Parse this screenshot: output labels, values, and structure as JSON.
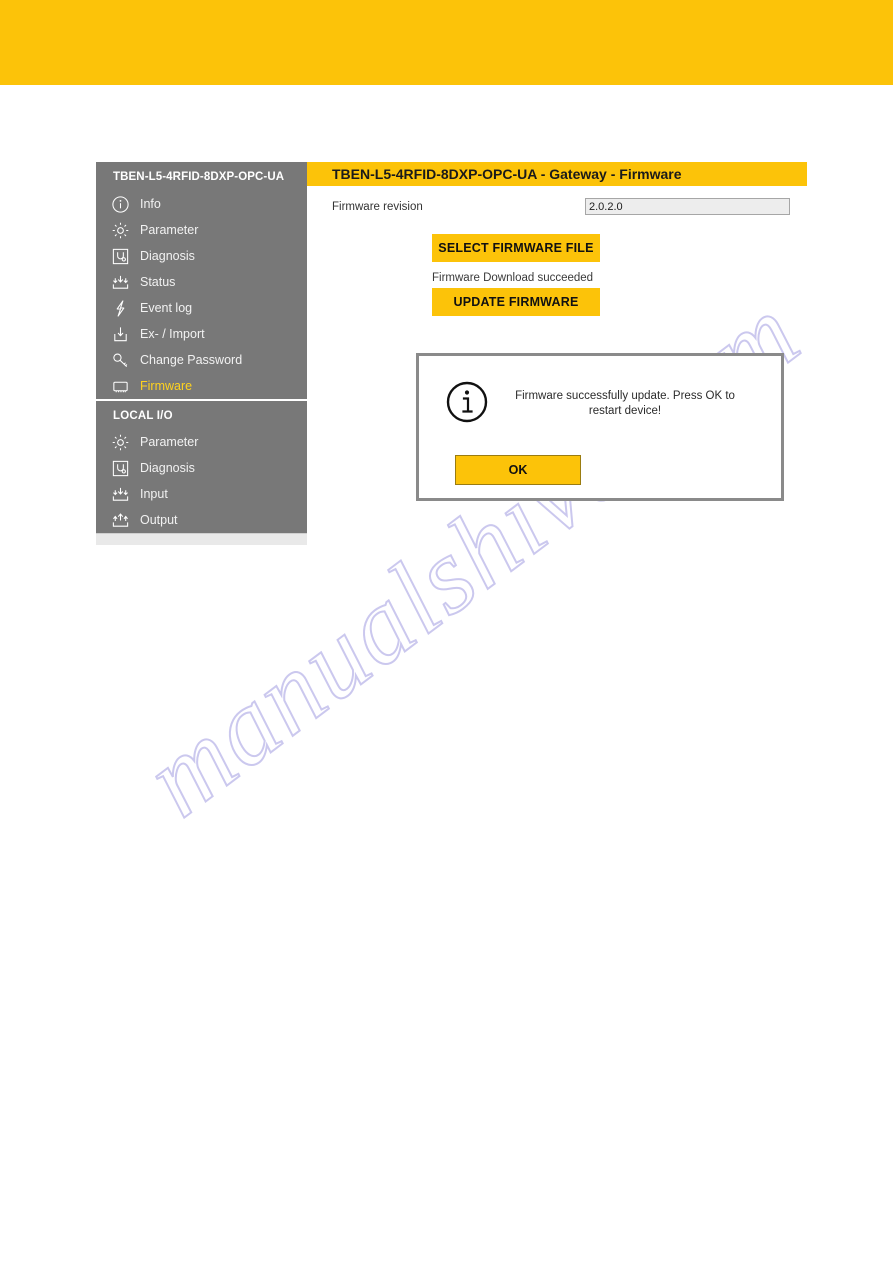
{
  "branding": {
    "banner_color": "#FCC309"
  },
  "watermark": {
    "text": "manualshive.com"
  },
  "sidebar": {
    "device_title": "TBEN-L5-4RFID-8DXP-OPC-UA",
    "gateway_items": [
      {
        "label": "Info",
        "icon": "info-circle-icon",
        "active": false
      },
      {
        "label": "Parameter",
        "icon": "gear-icon",
        "active": false
      },
      {
        "label": "Diagnosis",
        "icon": "stethoscope-icon",
        "active": false
      },
      {
        "label": "Status",
        "icon": "status-icon",
        "active": false
      },
      {
        "label": "Event log",
        "icon": "lightning-icon",
        "active": false
      },
      {
        "label": "Ex- / Import",
        "icon": "import-icon",
        "active": false
      },
      {
        "label": "Change Password",
        "icon": "key-icon",
        "active": false
      },
      {
        "label": "Firmware",
        "icon": "chip-icon",
        "active": true
      }
    ],
    "section_label": "LOCAL I/O",
    "local_io_items": [
      {
        "label": "Parameter",
        "icon": "gear-icon",
        "active": false
      },
      {
        "label": "Diagnosis",
        "icon": "stethoscope-icon",
        "active": false
      },
      {
        "label": "Input",
        "icon": "input-icon",
        "active": false
      },
      {
        "label": "Output",
        "icon": "output-icon",
        "active": false
      }
    ],
    "active_item_color": "#FFD21E"
  },
  "main": {
    "page_title": "TBEN-L5-4RFID-8DXP-OPC-UA - Gateway - Firmware",
    "firmware_revision_label": "Firmware revision",
    "firmware_revision_value": "2.0.2.0",
    "select_firmware_button": "SELECT FIRMWARE FILE",
    "download_status": "Firmware Download succeeded",
    "update_firmware_button": "UPDATE FIRMWARE"
  },
  "dialog": {
    "icon": "info-circle-icon",
    "message": "Firmware successfully update. Press OK to restart device!",
    "ok_button": "OK"
  }
}
